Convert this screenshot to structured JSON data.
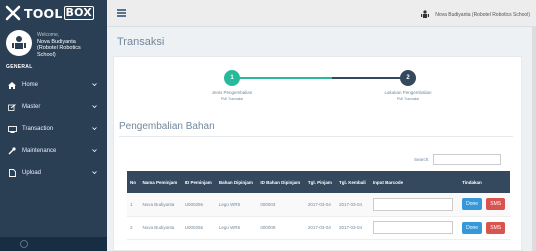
{
  "brand": {
    "name": "TOOL",
    "box": "BOX"
  },
  "profile": {
    "welcome": "Welcome,",
    "name_lines": [
      "Nova Budiyanta",
      "(Robotel Robotics",
      "School)"
    ]
  },
  "sidebar": {
    "section": "GENERAL",
    "items": [
      {
        "label": "Home",
        "icon": "home-icon"
      },
      {
        "label": "Master",
        "icon": "edit-icon"
      },
      {
        "label": "Transaction",
        "icon": "monitor-icon"
      },
      {
        "label": "Maintenance",
        "icon": "wrench-icon"
      },
      {
        "label": "Upload",
        "icon": "file-icon"
      }
    ]
  },
  "topnav": {
    "user": "Nova Budiyanta (Robotel Robotics School)"
  },
  "page": {
    "title": "Transaksi"
  },
  "wizard": {
    "steps": [
      {
        "number": "1",
        "label": "Jenis Pengembalian",
        "sub": "PMI Transaksi"
      },
      {
        "number": "2",
        "label": "Lakukan Pengembalian",
        "sub": "PMI Transaksi"
      }
    ]
  },
  "section": {
    "title": "Pengembalian Bahan"
  },
  "search": {
    "label": "Search:",
    "value": ""
  },
  "table": {
    "headers": [
      "No",
      "Nama Peminjam",
      "ID Peminjam",
      "Bahan Dipinjam",
      "ID Bahan Dipinjam",
      "Tgl. Pinjam",
      "Tgl. Kembali",
      "Input Barcode",
      "Tindakan"
    ],
    "rows": [
      [
        "1",
        "Nova Budiyanta",
        "U000256",
        "Lego WR5",
        "000003",
        "2017-03-04",
        "2017-03-04"
      ],
      [
        "2",
        "Nova Budiyanta",
        "U000256",
        "Lego WR5",
        "000009",
        "2017-03-04",
        "2017-03-04"
      ]
    ],
    "btn_done": "Done",
    "btn_sms": "SMS"
  },
  "colors": {
    "sidebar": "#2a3f54",
    "accent_green": "#26b99a",
    "dark": "#34495e",
    "done": "#3498db",
    "sms": "#d9534f"
  }
}
